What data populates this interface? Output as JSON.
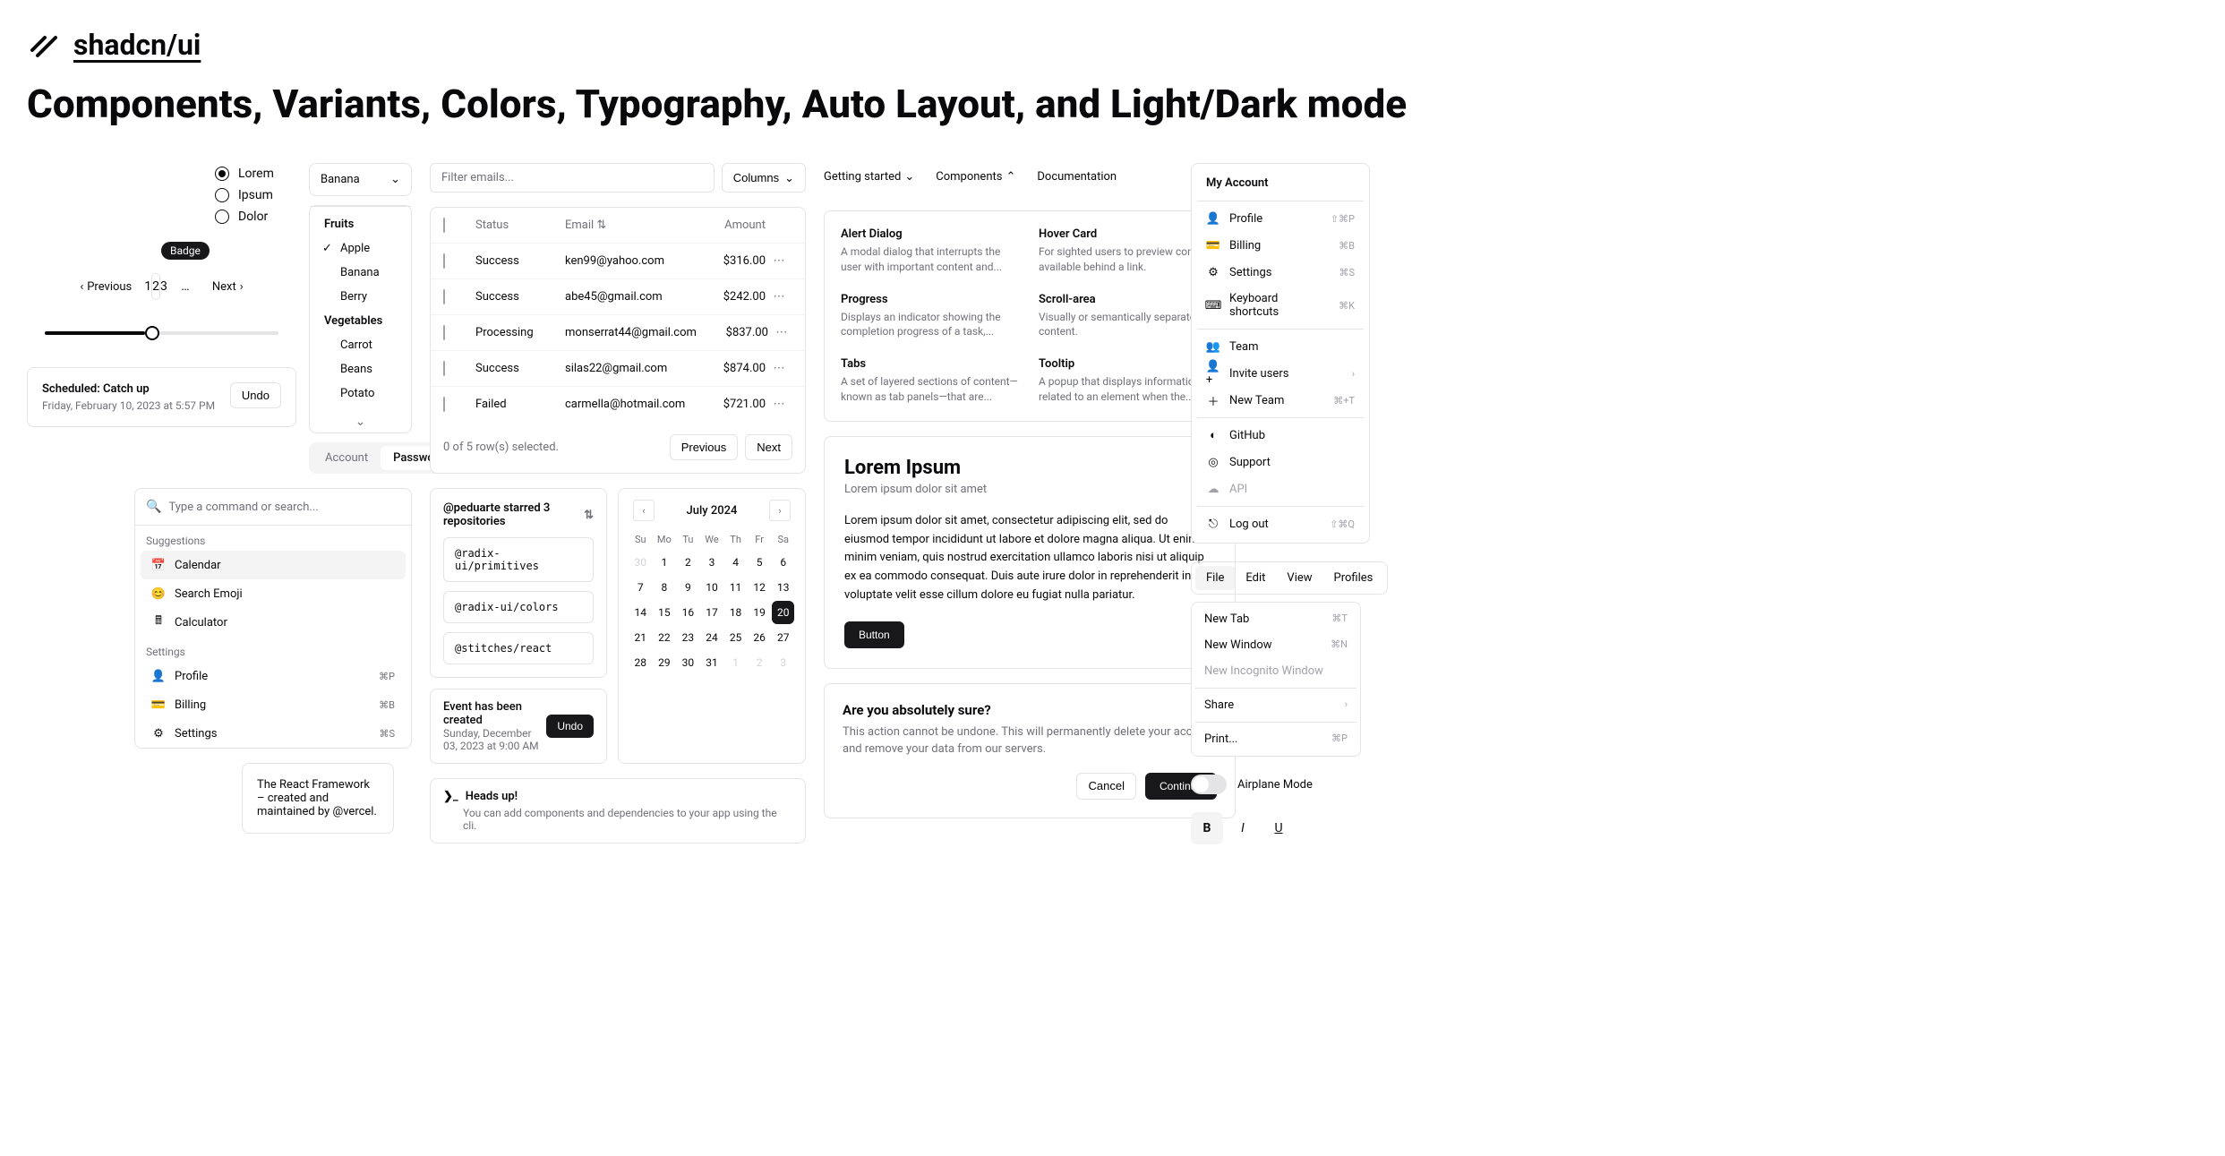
{
  "brand": "shadcn/ui",
  "title": "Components, Variants, Colors, Typography, Auto Layout, and Light/Dark mode",
  "radios": {
    "options": [
      "Lorem",
      "Ipsum",
      "Dolor"
    ],
    "selected": 0
  },
  "badge": "Badge",
  "pagination": {
    "prev": "Previous",
    "next": "Next",
    "pages": [
      "1",
      "2",
      "3"
    ],
    "active": 1,
    "ellipsis": "…"
  },
  "toast": {
    "title": "Scheduled: Catch up",
    "sub": "Friday, February 10, 2023 at 5:57 PM",
    "undo": "Undo"
  },
  "select": {
    "value": "Banana",
    "groups": [
      {
        "label": "Fruits",
        "items": [
          "Apple",
          "Banana",
          "Berry"
        ],
        "selected": "Apple"
      },
      {
        "label": "Vegetables",
        "items": [
          "Carrot",
          "Beans",
          "Potato"
        ]
      }
    ]
  },
  "tabs": {
    "items": [
      "Account",
      "Password"
    ],
    "active": 1
  },
  "command": {
    "placeholder": "Type a command or search...",
    "suggestions_label": "Suggestions",
    "suggestions": [
      "Calendar",
      "Search Emoji",
      "Calculator"
    ],
    "settings_label": "Settings",
    "settings": [
      {
        "label": "Profile",
        "kbd": "⌘P"
      },
      {
        "label": "Billing",
        "kbd": "⌘B"
      },
      {
        "label": "Settings",
        "kbd": "⌘S"
      }
    ]
  },
  "hover": "The React Framework – created and maintained by @vercel.",
  "table": {
    "filter_placeholder": "Filter emails...",
    "columns_btn": "Columns",
    "headers": {
      "status": "Status",
      "email": "Email",
      "amount": "Amount"
    },
    "rows": [
      {
        "status": "Success",
        "email": "ken99@yahoo.com",
        "amount": "$316.00"
      },
      {
        "status": "Success",
        "email": "abe45@gmail.com",
        "amount": "$242.00"
      },
      {
        "status": "Processing",
        "email": "monserrat44@gmail.com",
        "amount": "$837.00"
      },
      {
        "status": "Success",
        "email": "silas22@gmail.com",
        "amount": "$874.00"
      },
      {
        "status": "Failed",
        "email": "carmella@hotmail.com",
        "amount": "$721.00"
      }
    ],
    "footer": "0 of 5 row(s) selected.",
    "prev": "Previous",
    "next": "Next"
  },
  "collapsible": {
    "title": "@peduarte starred 3 repositories",
    "items": [
      "@radix-ui/primitives",
      "@radix-ui/colors",
      "@stitches/react"
    ]
  },
  "mini_toast": {
    "title": "Event has been created",
    "sub": "Sunday, December 03, 2023 at 9:00 AM",
    "undo": "Undo"
  },
  "alert": {
    "title": "Heads up!",
    "desc": "You can add components and dependencies to your app using the cli."
  },
  "calendar": {
    "month": "July 2024",
    "dow": [
      "Su",
      "Mo",
      "Tu",
      "We",
      "Th",
      "Fr",
      "Sa"
    ],
    "lead_out": [
      "30"
    ],
    "days": [
      "1",
      "2",
      "3",
      "4",
      "5",
      "6",
      "7",
      "8",
      "9",
      "10",
      "11",
      "12",
      "13",
      "14",
      "15",
      "16",
      "17",
      "18",
      "19",
      "20",
      "21",
      "22",
      "23",
      "24",
      "25",
      "26",
      "27",
      "28",
      "29",
      "30",
      "31"
    ],
    "trail_out": [
      "1",
      "2",
      "3"
    ],
    "today": "20"
  },
  "nav": {
    "items": [
      {
        "label": "Getting started",
        "open": false
      },
      {
        "label": "Components",
        "open": true
      },
      {
        "label": "Documentation"
      }
    ]
  },
  "mega": [
    {
      "t": "Alert Dialog",
      "d": "A modal dialog that interrupts the user with important content and..."
    },
    {
      "t": "Hover Card",
      "d": "For sighted users to preview content available behind a link."
    },
    {
      "t": "Progress",
      "d": "Displays an indicator showing the completion progress of a task,..."
    },
    {
      "t": "Scroll-area",
      "d": "Visually or semantically separates content."
    },
    {
      "t": "Tabs",
      "d": "A set of layered sections of content—known as tab panels—that are..."
    },
    {
      "t": "Tooltip",
      "d": "A popup that displays information related to an element when the..."
    }
  ],
  "article": {
    "h": "Lorem Ipsum",
    "sub": "Lorem ipsum dolor sit amet",
    "body": "Lorem ipsum dolor sit amet, consectetur adipiscing elit, sed do eiusmod tempor incididunt ut labore et dolore magna aliqua. Ut enim ad minim veniam, quis nostrud exercitation ullamco laboris nisi ut aliquip ex ea commodo consequat. Duis aute irure dolor in reprehenderit in voluptate velit esse cillum dolore eu fugiat nulla pariatur.",
    "button": "Button"
  },
  "dialog": {
    "t": "Are you absolutely sure?",
    "d": "This action cannot be undone. This will permanently delete your account and remove your data from our servers.",
    "cancel": "Cancel",
    "continue": "Continue"
  },
  "account_menu": {
    "title": "My Account",
    "g1": [
      {
        "label": "Profile",
        "kbd": "⇧⌘P",
        "icon": "user"
      },
      {
        "label": "Billing",
        "kbd": "⌘B",
        "icon": "card"
      },
      {
        "label": "Settings",
        "kbd": "⌘S",
        "icon": "gear"
      },
      {
        "label": "Keyboard shortcuts",
        "kbd": "⌘K",
        "icon": "keyboard"
      }
    ],
    "g2": [
      {
        "label": "Team",
        "icon": "users"
      },
      {
        "label": "Invite users",
        "sub": true,
        "icon": "user-plus"
      },
      {
        "label": "New Team",
        "kbd": "⌘+T",
        "icon": "plus"
      }
    ],
    "g3": [
      {
        "label": "GitHub",
        "icon": "github"
      },
      {
        "label": "Support",
        "icon": "life"
      },
      {
        "label": "API",
        "disabled": true,
        "icon": "cloud"
      }
    ],
    "logout": {
      "label": "Log out",
      "kbd": "⇧⌘Q",
      "icon": "logout"
    }
  },
  "menubar": {
    "items": [
      "File",
      "Edit",
      "View",
      "Profiles"
    ],
    "active": 0
  },
  "filemenu": [
    {
      "label": "New Tab",
      "kbd": "⌘T"
    },
    {
      "label": "New Window",
      "kbd": "⌘N"
    },
    {
      "label": "New Incognito Window",
      "disabled": true
    },
    {
      "sep": true
    },
    {
      "label": "Share",
      "sub": true
    },
    {
      "sep": true
    },
    {
      "label": "Print...",
      "kbd": "⌘P"
    }
  ],
  "switch_label": "Airplane Mode",
  "toggles": [
    "B",
    "I",
    "U"
  ]
}
